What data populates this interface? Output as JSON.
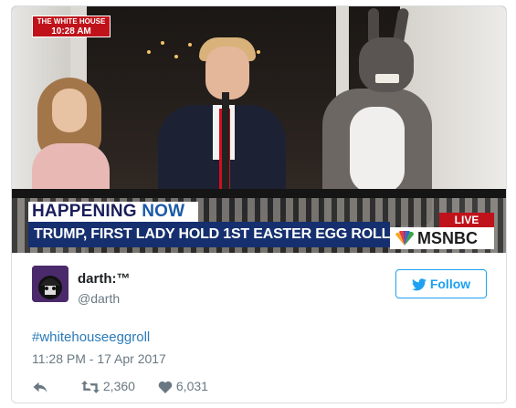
{
  "video": {
    "time_label": "THE WHITE HOUSE",
    "time_value": "10:28 AM",
    "banner_happening": "HAPPENING",
    "banner_now": "NOW",
    "headline": "TRUMP, FIRST LADY HOLD 1ST EASTER EGG ROLL",
    "live_label": "LIVE",
    "network": "MSNBC"
  },
  "tweet": {
    "display_name": "darth:™",
    "handle": "@darth",
    "follow_label": "Follow",
    "text": "#whitehouseeggroll",
    "timestamp": "11:28 PM - 17 Apr 2017",
    "retweets": "2,360",
    "likes": "6,031"
  },
  "colors": {
    "twitter_blue": "#1da1f2",
    "hashtag_blue": "#2b7bb9",
    "news_red": "#c0121a",
    "news_navy": "#16306f"
  },
  "icons": [
    "twitter-bird-icon",
    "reply-icon",
    "retweet-icon",
    "heart-icon",
    "peacock-icon"
  ]
}
